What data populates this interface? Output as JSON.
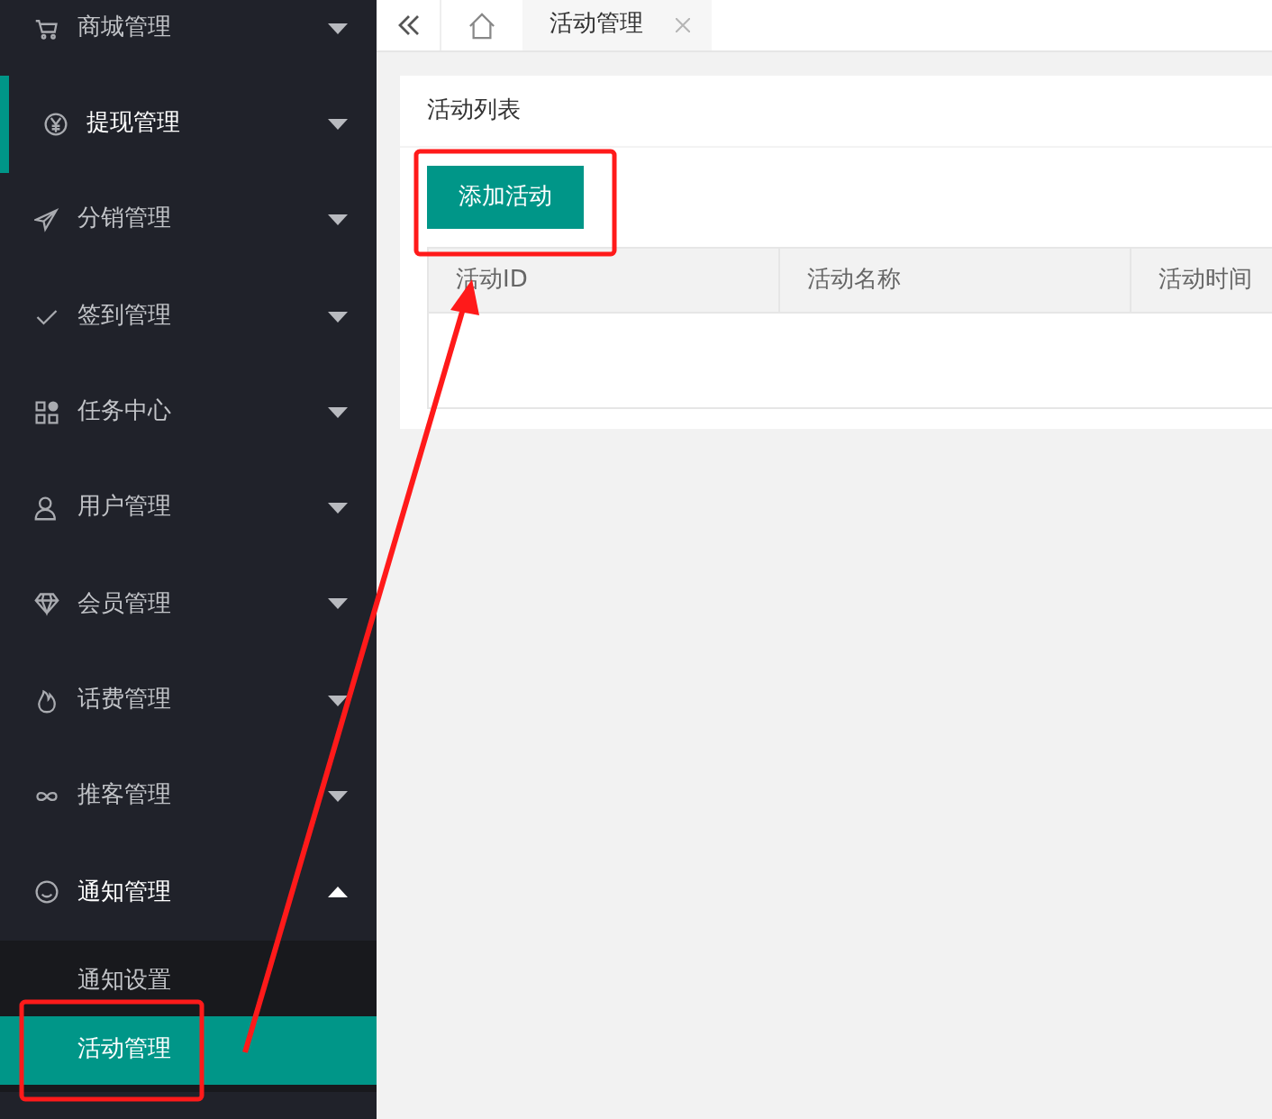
{
  "sidebar": {
    "items": [
      {
        "label": "商城管理",
        "selected": false,
        "expanded": false
      },
      {
        "label": "提现管理",
        "selected": true,
        "expanded": false
      },
      {
        "label": "分销管理",
        "selected": false,
        "expanded": false
      },
      {
        "label": "签到管理",
        "selected": false,
        "expanded": false
      },
      {
        "label": "任务中心",
        "selected": false,
        "expanded": false
      },
      {
        "label": "用户管理",
        "selected": false,
        "expanded": false
      },
      {
        "label": "会员管理",
        "selected": false,
        "expanded": false
      },
      {
        "label": "话费管理",
        "selected": false,
        "expanded": false
      },
      {
        "label": "推客管理",
        "selected": false,
        "expanded": false
      },
      {
        "label": "通知管理",
        "selected": false,
        "expanded": true,
        "children": [
          {
            "label": "通知设置",
            "selected": false
          },
          {
            "label": "活动管理",
            "selected": true
          }
        ]
      }
    ]
  },
  "tabs": [
    {
      "label": "活动管理",
      "selected": true
    }
  ],
  "card": {
    "title": "活动列表",
    "add_button": "添加活动",
    "table": {
      "columns": [
        "活动ID",
        "活动名称",
        "活动时间"
      ]
    }
  }
}
